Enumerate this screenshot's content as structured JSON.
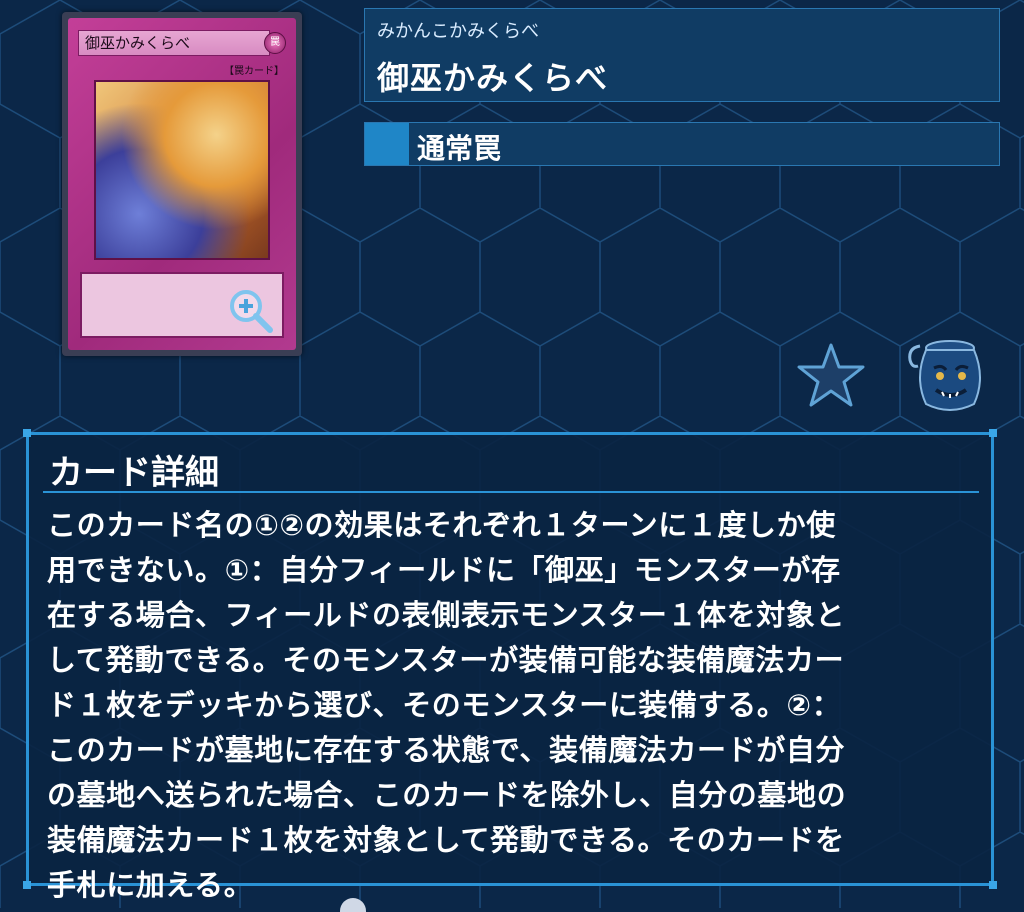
{
  "card": {
    "reading": "みかんこかみくらべ",
    "name": "御巫かみくらべ",
    "type": "通常罠",
    "thumbnail": {
      "name": "御巫かみくらべ",
      "type_label": "【罠カード】",
      "attribute": "罠"
    }
  },
  "details": {
    "header": "カード詳細",
    "text": "このカード名の①②の効果はそれぞれ１ターンに１度しか使\n用できない。①：自分フィールドに「御巫」モンスターが存\n在する場合、フィールドの表側表示モンスター１体を対象と\nして発動できる。そのモンスターが装備可能な装備魔法カー\nド１枚をデッキから選び、そのモンスターに装備する。②：\nこのカードが墓地に存在する状態で、装備魔法カードが自分\nの墓地へ送られた場合、このカードを除外し、自分の墓地の\n装備魔法カード１枚を対象として発動できる。そのカードを\n手札に加える。"
  },
  "icons": {
    "zoom": "zoom-in-icon",
    "favorite": "star-icon",
    "pot": "pot-of-desires-icon"
  },
  "colors": {
    "background": "#0b2748",
    "panel": "#103c64",
    "accent": "#2a93d6",
    "trap_card": "#b23a8f"
  }
}
